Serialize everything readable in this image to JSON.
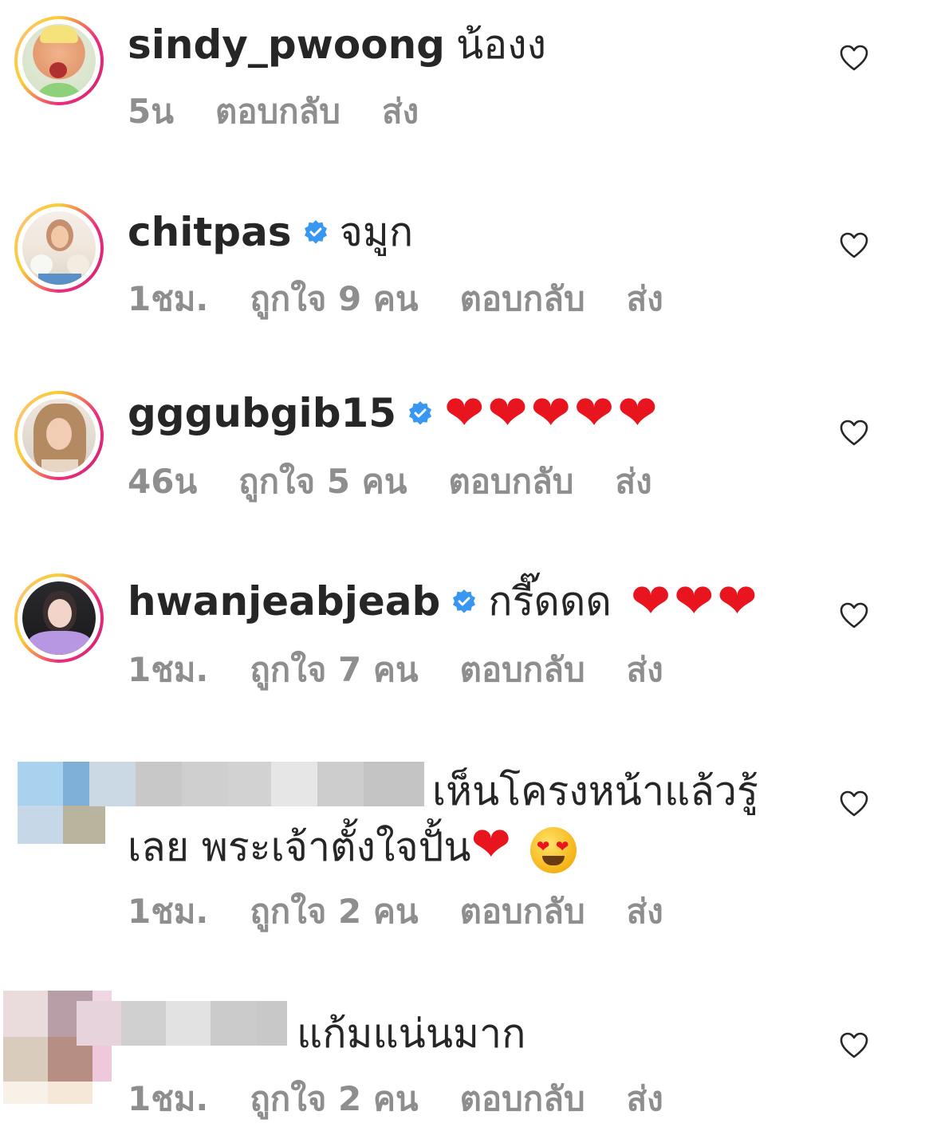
{
  "colors": {
    "text": "#262626",
    "meta": "#8e8e8e",
    "verified_badge": "#3897f0",
    "heart_emoji": "#e8141e"
  },
  "comments": [
    {
      "username": "sindy_pwoong",
      "verified": false,
      "text": "น้องง",
      "time": "5น",
      "likes": "",
      "reply": "ตอบกลับ",
      "send": "ส่ง"
    },
    {
      "username": "chitpas",
      "verified": true,
      "text": "จมูก",
      "time": "1ชม.",
      "likes": "ถูกใจ 9 คน",
      "reply": "ตอบกลับ",
      "send": "ส่ง"
    },
    {
      "username": "gggubgib15",
      "verified": true,
      "text": "",
      "emoji": "❤️❤️❤️❤️❤️",
      "time": "46น",
      "likes": "ถูกใจ 5 คน",
      "reply": "ตอบกลับ",
      "send": "ส่ง"
    },
    {
      "username": "hwanjeabjeab",
      "verified": true,
      "text": "กรี๊ดดด",
      "emoji": "❤️❤️❤️",
      "time": "1ชม.",
      "likes": "ถูกใจ 7 คน",
      "reply": "ตอบกลับ",
      "send": "ส่ง"
    },
    {
      "username": "",
      "verified": false,
      "text_line1": "เห็นโครงหน้าแล้วรู้",
      "text_line2": "เลย พระเจ้าตั้งใจปั้น",
      "emoji": "❤️😍",
      "time": "1ชม.",
      "likes": "ถูกใจ 2 คน",
      "reply": "ตอบกลับ",
      "send": "ส่ง"
    },
    {
      "username": "",
      "verified": false,
      "text": "แก้มแน่นมาก",
      "time": "1ชม.",
      "likes": "ถูกใจ 2 คน",
      "reply": "ตอบกลับ",
      "send": "ส่ง"
    }
  ]
}
